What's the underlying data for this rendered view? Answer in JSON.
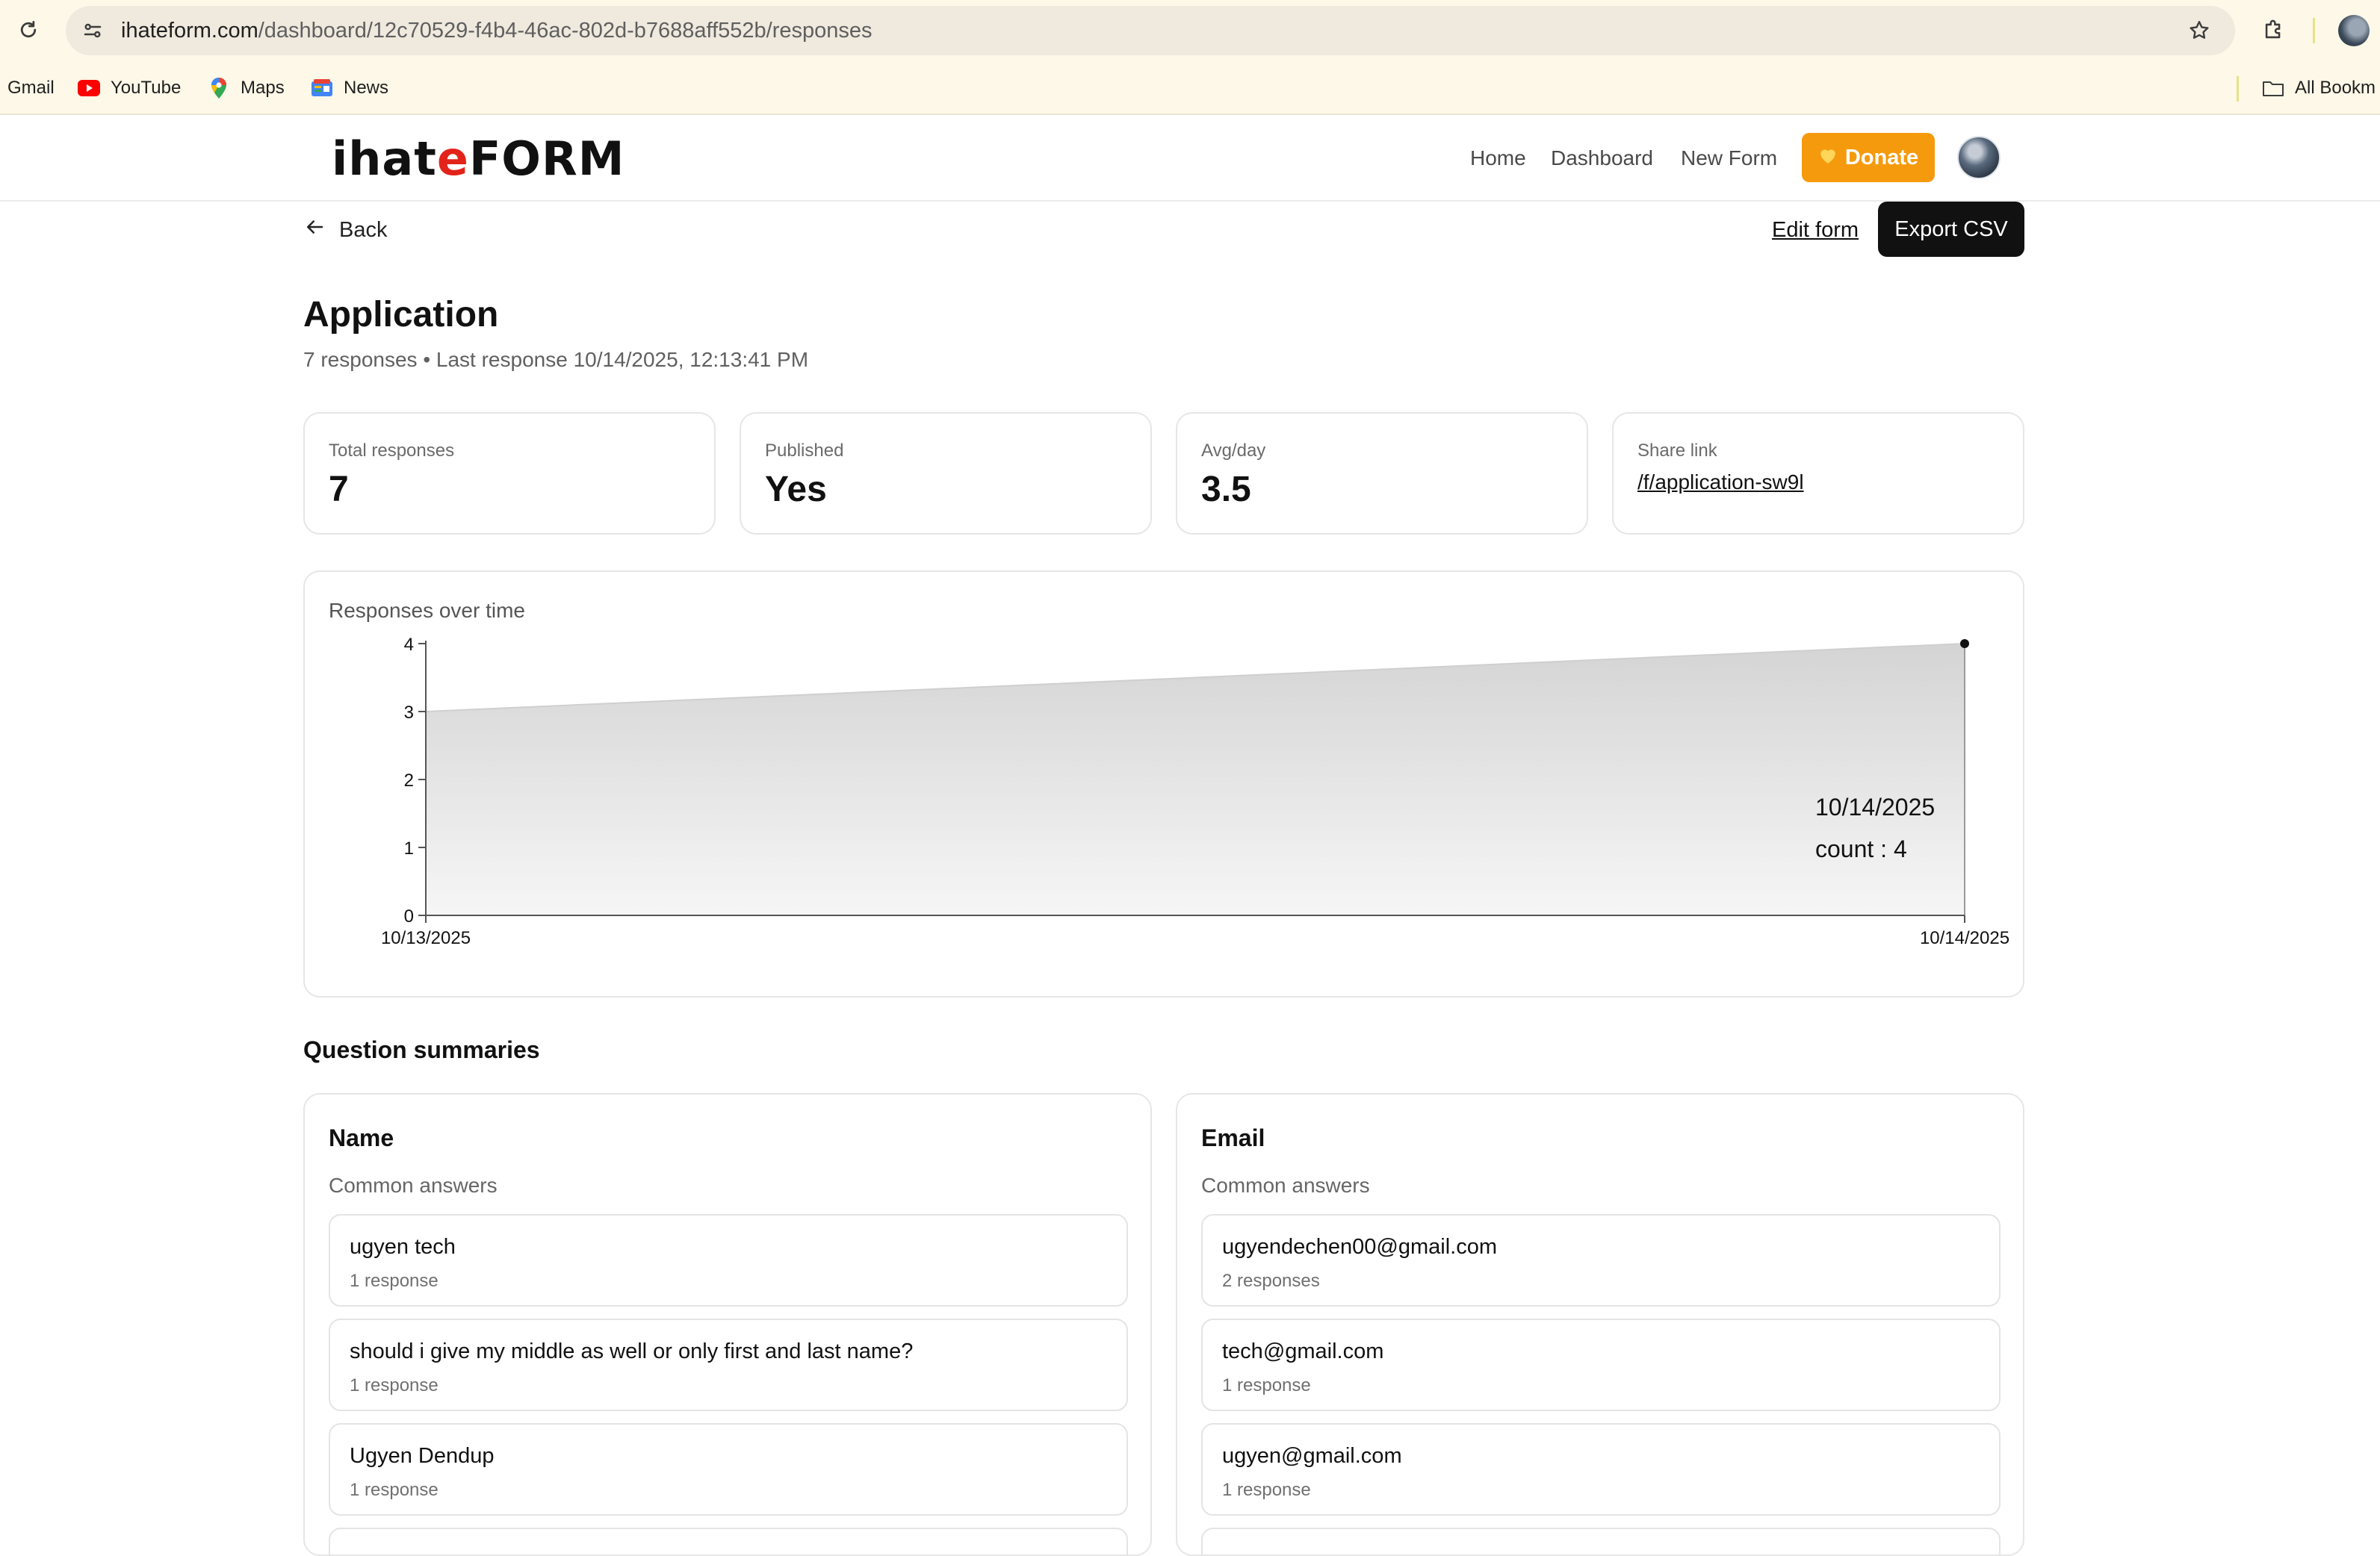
{
  "browser": {
    "url_host": "ihateform.com",
    "url_path": "/dashboard/12c70529-f4b4-46ac-802d-b7688aff552b/responses",
    "bookmarks": [
      "Gmail",
      "YouTube",
      "Maps",
      "News"
    ],
    "all_bookmarks_label": "All Bookm"
  },
  "header": {
    "logo_pre": "ihat",
    "logo_accent": "e",
    "logo_post": "FORM",
    "nav": [
      "Home",
      "Dashboard",
      "New Form"
    ],
    "donate_label": "Donate"
  },
  "toolbar": {
    "back_label": "Back",
    "edit_label": "Edit form",
    "export_label": "Export CSV"
  },
  "page": {
    "title": "Application",
    "subtitle": "7 responses • Last response 10/14/2025, 12:13:41 PM"
  },
  "stats": [
    {
      "label": "Total responses",
      "value": "7"
    },
    {
      "label": "Published",
      "value": "Yes"
    },
    {
      "label": "Avg/day",
      "value": "3.5"
    },
    {
      "label": "Share link",
      "value": "/f/application-sw9l"
    }
  ],
  "chart_data": {
    "type": "area",
    "title": "Responses over time",
    "x": [
      "10/13/2025",
      "10/14/2025"
    ],
    "values": [
      3,
      4
    ],
    "ylim": [
      0,
      4
    ],
    "yticks": [
      0,
      1,
      2,
      3,
      4
    ],
    "tooltip": {
      "date": "10/14/2025",
      "text": "count : 4"
    }
  },
  "summaries": {
    "title": "Question summaries",
    "questions": [
      {
        "title": "Name",
        "subtitle": "Common answers",
        "answers": [
          {
            "text": "ugyen tech",
            "count": "1 response"
          },
          {
            "text": "should i give my middle as well or only first and last name?",
            "count": "1 response"
          },
          {
            "text": "Ugyen Dendup",
            "count": "1 response"
          }
        ]
      },
      {
        "title": "Email",
        "subtitle": "Common answers",
        "answers": [
          {
            "text": "ugyendechen00@gmail.com",
            "count": "2 responses"
          },
          {
            "text": "tech@gmail.com",
            "count": "1 response"
          },
          {
            "text": "ugyen@gmail.com",
            "count": "1 response"
          }
        ]
      }
    ]
  }
}
